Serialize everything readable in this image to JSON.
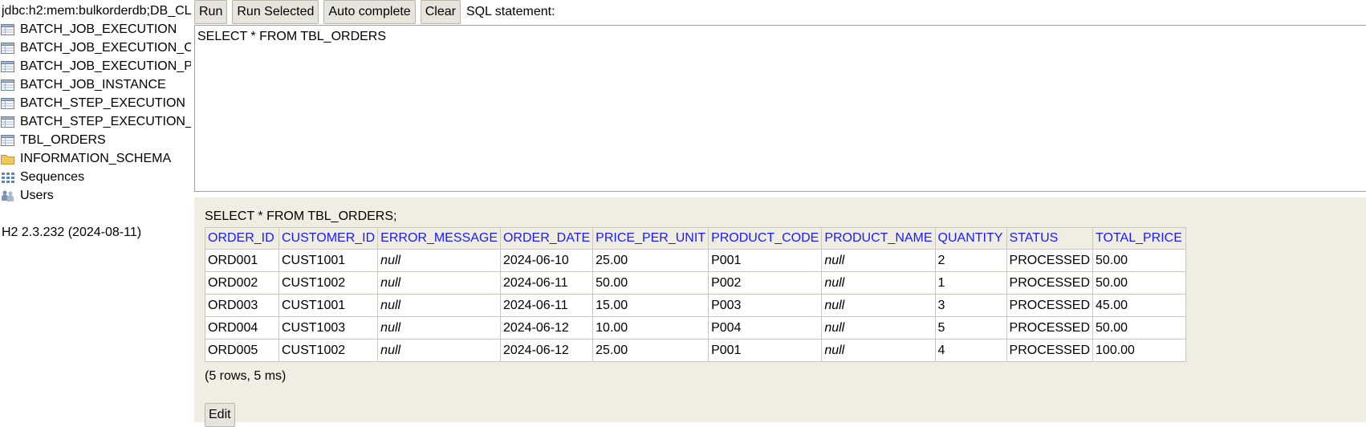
{
  "sidebar": {
    "connection": "jdbc:h2:mem:bulkorderdb;DB_CL",
    "items": [
      {
        "label": "BATCH_JOB_EXECUTION",
        "icon": "table-icon"
      },
      {
        "label": "BATCH_JOB_EXECUTION_C",
        "icon": "table-icon"
      },
      {
        "label": "BATCH_JOB_EXECUTION_P",
        "icon": "table-icon"
      },
      {
        "label": "BATCH_JOB_INSTANCE",
        "icon": "table-icon"
      },
      {
        "label": "BATCH_STEP_EXECUTION",
        "icon": "table-icon"
      },
      {
        "label": "BATCH_STEP_EXECUTION_",
        "icon": "table-icon"
      },
      {
        "label": "TBL_ORDERS",
        "icon": "table-icon"
      },
      {
        "label": "INFORMATION_SCHEMA",
        "icon": "folder-icon"
      },
      {
        "label": "Sequences",
        "icon": "sequence-icon"
      },
      {
        "label": "Users",
        "icon": "users-icon"
      }
    ],
    "version": "H2 2.3.232 (2024-08-11)"
  },
  "toolbar": {
    "run": "Run",
    "run_selected": "Run Selected",
    "auto_complete": "Auto complete",
    "clear": "Clear",
    "sql_label": "SQL statement:"
  },
  "editor": {
    "text": "SELECT * FROM TBL_ORDERS"
  },
  "result": {
    "statement": "SELECT * FROM TBL_ORDERS;",
    "columns": [
      "ORDER_ID",
      "CUSTOMER_ID",
      "ERROR_MESSAGE",
      "ORDER_DATE",
      "PRICE_PER_UNIT",
      "PRODUCT_CODE",
      "PRODUCT_NAME",
      "QUANTITY",
      "STATUS",
      "TOTAL_PRICE"
    ],
    "rows": [
      [
        "ORD001",
        "CUST1001",
        "null",
        "2024-06-10",
        "25.00",
        "P001",
        "null",
        "2",
        "PROCESSED",
        "50.00"
      ],
      [
        "ORD002",
        "CUST1002",
        "null",
        "2024-06-11",
        "50.00",
        "P002",
        "null",
        "1",
        "PROCESSED",
        "50.00"
      ],
      [
        "ORD003",
        "CUST1001",
        "null",
        "2024-06-11",
        "15.00",
        "P003",
        "null",
        "3",
        "PROCESSED",
        "45.00"
      ],
      [
        "ORD004",
        "CUST1003",
        "null",
        "2024-06-12",
        "10.00",
        "P004",
        "null",
        "5",
        "PROCESSED",
        "50.00"
      ],
      [
        "ORD005",
        "CUST1002",
        "null",
        "2024-06-12",
        "25.00",
        "P001",
        "null",
        "4",
        "PROCESSED",
        "100.00"
      ]
    ],
    "row_count": "(5 rows, 5 ms)",
    "edit": "Edit"
  },
  "colors": {
    "header_link": "#1a1aff",
    "result_bg": "#f0eee2",
    "button_bg": "#e6e4dc"
  }
}
